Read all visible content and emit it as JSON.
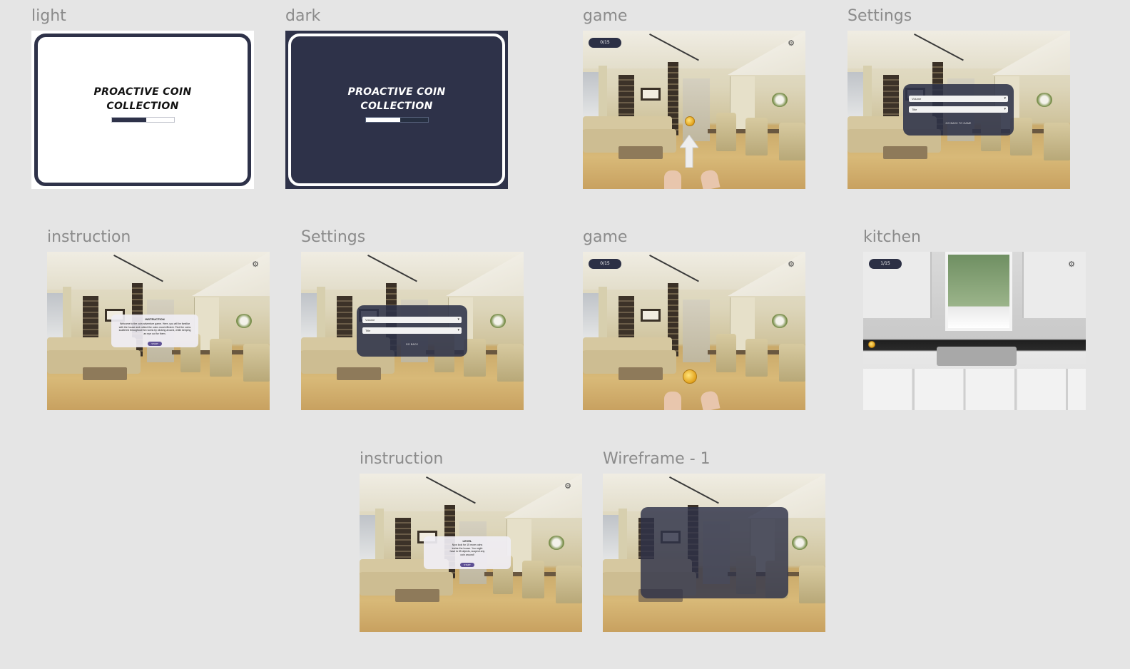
{
  "frames": [
    {
      "id": "light",
      "label": "light"
    },
    {
      "id": "dark",
      "label": "dark"
    },
    {
      "id": "game1",
      "label": "game"
    },
    {
      "id": "settings1",
      "label": "Settings"
    },
    {
      "id": "instruction1",
      "label": "instruction"
    },
    {
      "id": "settings2",
      "label": "Settings"
    },
    {
      "id": "game2",
      "label": "game"
    },
    {
      "id": "kitchen",
      "label": "kitchen"
    },
    {
      "id": "instruction2",
      "label": "instruction"
    },
    {
      "id": "wireframe",
      "label": "Wireframe - 1"
    }
  ],
  "splash": {
    "title_line1": "PROACTIVE COIN",
    "title_line2": "COLLECTION",
    "progress": 0.55
  },
  "game": {
    "counter_game1": "0/15",
    "counter_game2": "0/15",
    "counter_kitchen": "1/15"
  },
  "settings": {
    "volume_label": "Volume",
    "title_label": "Title",
    "back_button": "GO BACK TO GAME"
  },
  "settings2": {
    "volume_label": "Volume",
    "title_label": "Title",
    "back_button": "GO BACK"
  },
  "instruction1": {
    "title": "INSTRUCTION",
    "body": "Welcome to the coin adventure game. Here, you will be familiar with the house and collect the coins most efficient. Find the coins scattered throughout the rooms by clicking around, while keeping an eye out for them.",
    "button": "START"
  },
  "instruction2": {
    "title": "LEVEL",
    "body": "Now look for 15 more coins inside the house. You might have to lift objects, suspect any coin around!",
    "button": "START"
  },
  "icons": {
    "gear": "gear-icon",
    "arrow": "up-arrow-icon",
    "coin": "coin-icon"
  },
  "colors": {
    "canvas_bg": "#e5e5e5",
    "navy": "#2e3249",
    "accent_purple": "#5e5094",
    "coin_gold": "#e2a21b"
  }
}
